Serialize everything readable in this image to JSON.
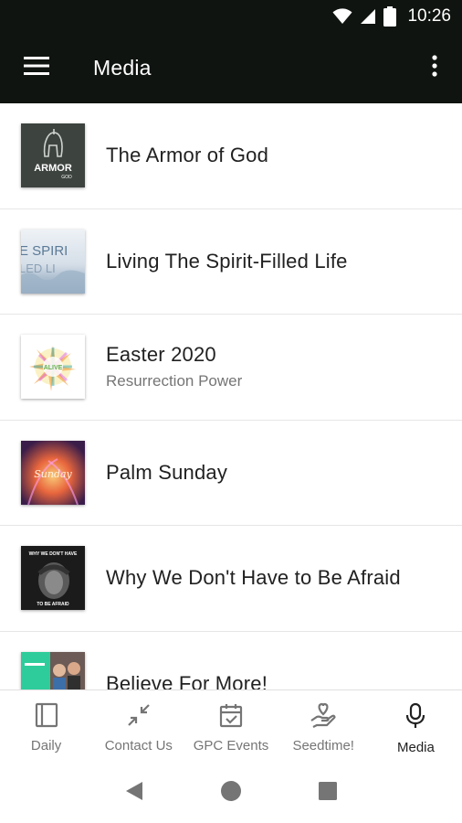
{
  "status_bar": {
    "time": "10:26"
  },
  "app_bar": {
    "title": "Media"
  },
  "media_items": [
    {
      "title": "The Armor of God",
      "subtitle": "",
      "thumb_text": "ARMOR",
      "thumb_subtext": "GOD"
    },
    {
      "title": "Living The Spirit-Filled Life",
      "subtitle": "",
      "thumb_text": "E SPIRI",
      "thumb_subtext": "LED LI"
    },
    {
      "title": "Easter 2020",
      "subtitle": "Resurrection Power",
      "thumb_text": "ALIVE",
      "thumb_subtext": ""
    },
    {
      "title": "Palm Sunday",
      "subtitle": "",
      "thumb_text": "Sunday",
      "thumb_subtext": ""
    },
    {
      "title": "Why We Don't Have to Be Afraid",
      "subtitle": "",
      "thumb_text": "WHY WE DON'T HAVE",
      "thumb_subtext": "TO BE AFRAID"
    },
    {
      "title": "Believe For More!",
      "subtitle": "",
      "thumb_text": "",
      "thumb_subtext": ""
    }
  ],
  "bottom_nav": [
    {
      "label": "Daily",
      "icon": "book-icon",
      "active": false
    },
    {
      "label": "Contact Us",
      "icon": "compress-icon",
      "active": false
    },
    {
      "label": "GPC Events",
      "icon": "calendar-check-icon",
      "active": false
    },
    {
      "label": "Seedtime!",
      "icon": "hand-heart-icon",
      "active": false
    },
    {
      "label": "Media",
      "icon": "microphone-icon",
      "active": true
    }
  ],
  "colors": {
    "app_bar": "#0f1410",
    "text_primary": "#212121",
    "text_secondary": "#757575"
  }
}
